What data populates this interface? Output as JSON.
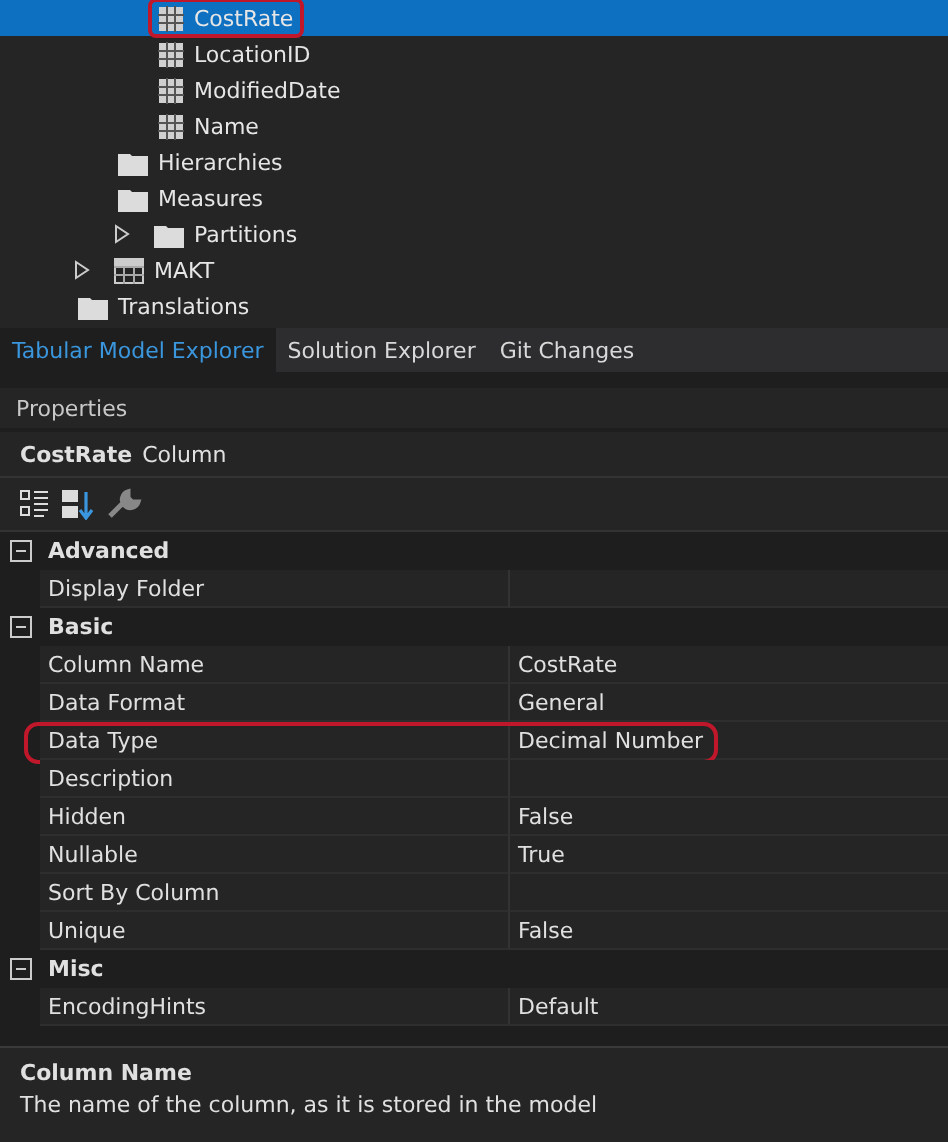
{
  "tree": {
    "items": [
      {
        "kind": "group",
        "children": [
          {
            "kind": "group",
            "children": [
              {
                "label": "CostRate",
                "kind": "column",
                "selected": true,
                "outlined": true
              },
              {
                "label": "LocationID",
                "kind": "column",
                "selected": false,
                "outlined": false
              },
              {
                "label": "ModifiedDate",
                "kind": "column",
                "selected": false,
                "outlined": false
              },
              {
                "label": "Name",
                "kind": "column",
                "selected": false,
                "outlined": false
              }
            ]
          },
          {
            "label": "Hierarchies",
            "kind": "folder",
            "selected": false,
            "outlined": false
          },
          {
            "label": "Measures",
            "kind": "folder",
            "selected": false,
            "outlined": false
          },
          {
            "label": "Partitions",
            "kind": "folder",
            "expanded": false,
            "selected": false,
            "outlined": false
          }
        ]
      },
      {
        "label": "MAKT",
        "kind": "table",
        "expanded": false,
        "selected": false,
        "outlined": false
      },
      {
        "label": "Translations",
        "kind": "folder",
        "selected": false,
        "outlined": false
      }
    ]
  },
  "tabs": [
    {
      "label": "Tabular Model Explorer",
      "selected": true
    },
    {
      "label": "Solution Explorer",
      "selected": false
    },
    {
      "label": "Git Changes",
      "selected": false
    }
  ],
  "properties": {
    "title": "Properties",
    "object_name": "CostRate",
    "object_type": "Column",
    "rows": [
      {
        "kind": "category",
        "name": "Advanced",
        "expanded": true
      },
      {
        "kind": "property",
        "name": "Display Folder",
        "outlined": false
      },
      {
        "kind": "category",
        "name": "Basic",
        "expanded": true
      },
      {
        "kind": "property",
        "name": "Column Name",
        "value": "CostRate",
        "outlined": false
      },
      {
        "kind": "property",
        "name": "Data Format",
        "value": "General",
        "outlined": false
      },
      {
        "kind": "property",
        "name": "Data Type",
        "value": "Decimal Number",
        "outlined": true
      },
      {
        "kind": "property",
        "name": "Description",
        "outlined": false
      },
      {
        "kind": "property",
        "name": "Hidden",
        "value": "False",
        "outlined": false
      },
      {
        "kind": "property",
        "name": "Nullable",
        "value": "True",
        "outlined": false
      },
      {
        "kind": "property",
        "name": "Sort By Column",
        "outlined": false
      },
      {
        "kind": "property",
        "name": "Unique",
        "value": "False",
        "outlined": false
      },
      {
        "kind": "category",
        "name": "Misc",
        "expanded": true
      },
      {
        "kind": "property",
        "name": "EncodingHints",
        "value": "Default",
        "outlined": false
      }
    ],
    "description": {
      "title": "Column Name",
      "text": "The name of the column, as it is stored in the model"
    }
  }
}
